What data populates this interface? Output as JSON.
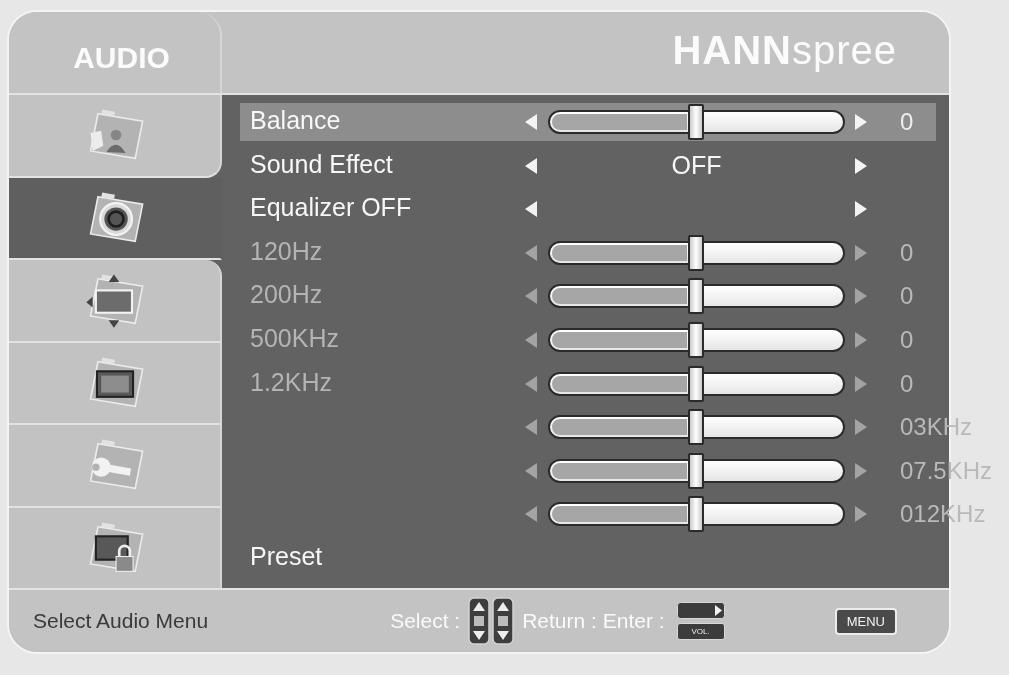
{
  "menu": {
    "title": "AUDIO",
    "logo": "**HANN**spree"
  },
  "sidebar": {
    "items": [
      {
        "kind": "person",
        "selected": false
      },
      {
        "kind": "speaker",
        "selected": true
      },
      {
        "kind": "screen",
        "selected": false
      },
      {
        "kind": "monitor",
        "selected": false
      },
      {
        "kind": "wrench",
        "selected": false
      },
      {
        "kind": "lock",
        "selected": false
      }
    ]
  },
  "rows": [
    {
      "kind": "slider",
      "label": "Balance",
      "selected": true,
      "disabled": false,
      "level": 0.5,
      "reading": "0"
    },
    {
      "kind": "option",
      "label": "Sound Effect",
      "selected": false,
      "disabled": false,
      "value": "OFF"
    },
    {
      "kind": "option",
      "label": "Equalizer OFF",
      "selected": false,
      "disabled": false
    },
    {
      "kind": "slider",
      "label": "120Hz",
      "selected": false,
      "disabled": true,
      "level": 0.5,
      "reading": "0"
    },
    {
      "kind": "slider",
      "label": "200Hz",
      "selected": false,
      "disabled": true,
      "level": 0.5,
      "reading": "0"
    },
    {
      "kind": "slider",
      "label": "500KHz",
      "selected": false,
      "disabled": true,
      "level": 0.5,
      "reading": "0"
    },
    {
      "kind": "slider",
      "label": "1.2KHz",
      "selected": false,
      "disabled": true,
      "level": 0.5,
      "reading": "0"
    },
    {
      "kind": "slider",
      "selected": false,
      "disabled": true,
      "level": 0.5,
      "reading": "03KHz"
    },
    {
      "kind": "slider",
      "selected": false,
      "disabled": true,
      "level": 0.5,
      "reading": "07.5KHz"
    },
    {
      "kind": "slider",
      "selected": false,
      "disabled": true,
      "level": 0.5,
      "reading": "012KHz"
    },
    {
      "kind": "plain",
      "label": "Preset",
      "selected": false,
      "disabled": false
    }
  ],
  "status_bar": {
    "hint": "Select Audio Menu",
    "select_label": "Select :",
    "return_enter_label": "Return : Enter :",
    "volume_key": "VOL.",
    "menu_key": "MENU"
  }
}
